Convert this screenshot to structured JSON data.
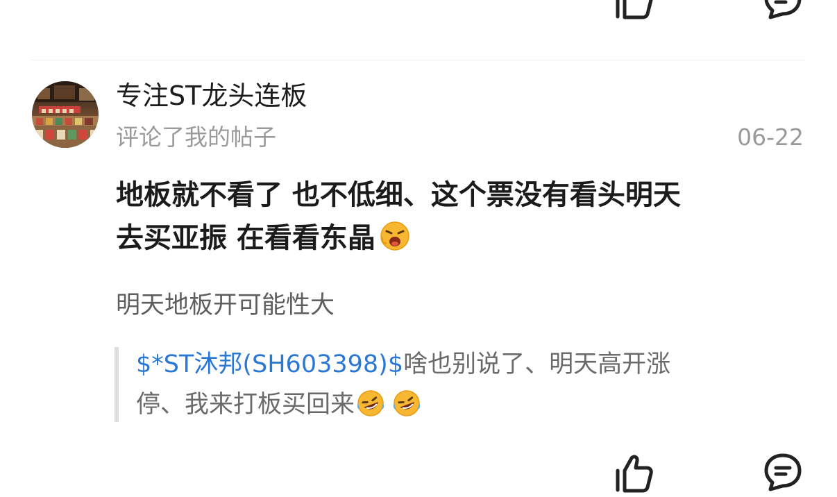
{
  "comment": {
    "username": "专注ST龙头连板",
    "subtitle": "评论了我的帖子",
    "date": "06-22",
    "body_line1": "地板就不看了 也不低细、这个票没有看头明天",
    "body_line2": "去买亚振 在看看东晶",
    "body_emoji": "yawning-face-icon",
    "reply": "明天地板开可能性大",
    "quote": {
      "stock_tag": "$*ST沐邦(SH603398)$",
      "text_part1": "啥也别说了、明天高开涨",
      "text_part2": "停、我来打板买回来",
      "emojis": [
        "laughing-crying-face-icon",
        "laughing-crying-face-icon"
      ]
    }
  },
  "actions": {
    "like_icon": "thumbs-up-icon",
    "comment_icon": "comment-bubble-icon"
  },
  "colors": {
    "link": "#2a78d4",
    "secondary_text": "#9a9a9a",
    "quote_bar": "#dddddd"
  }
}
